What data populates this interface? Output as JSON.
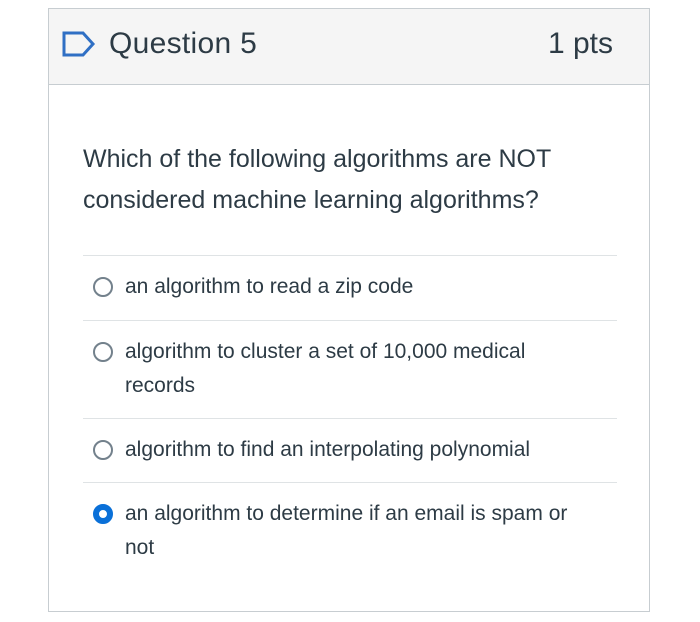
{
  "question": {
    "title": "Question 5",
    "points": "1 pts",
    "icon": "flag-outline-icon",
    "text": "Which of the following algorithms are NOT considered machine learning algorithms?"
  },
  "answers": [
    {
      "label": "an algorithm to read a zip code",
      "selected": false
    },
    {
      "label": "algorithm to cluster a set of 10,000 medical records",
      "selected": false
    },
    {
      "label": "algorithm to find an interpolating polynomial",
      "selected": false
    },
    {
      "label": "an algorithm to determine if an email is spam or not",
      "selected": true
    }
  ],
  "colors": {
    "accent": "#0a70d8",
    "text": "#2d3b45",
    "border": "#c7cdd1",
    "header_bg": "#f5f5f5"
  }
}
